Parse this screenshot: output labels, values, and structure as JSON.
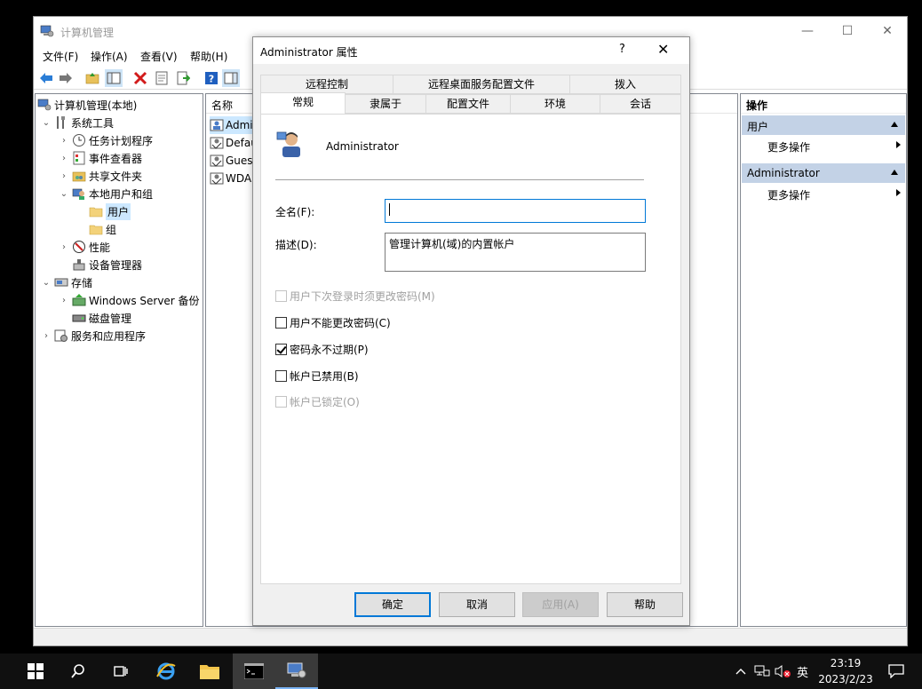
{
  "window": {
    "title": "计算机管理",
    "minimize": "—",
    "maximize": "☐",
    "close": "✕"
  },
  "menu": [
    "文件(F)",
    "操作(A)",
    "查看(V)",
    "帮助(H)"
  ],
  "toolbar_icons": [
    "back-icon",
    "forward-icon",
    "up-folder-icon",
    "show-hide-tree-icon",
    "delete-icon",
    "properties-icon",
    "export-icon",
    "help-icon",
    "show-action-pane-icon"
  ],
  "tree": {
    "root": "计算机管理(本地)",
    "system_tools": "系统工具",
    "task_scheduler": "任务计划程序",
    "event_viewer": "事件查看器",
    "shared_folders": "共享文件夹",
    "local_users": "本地用户和组",
    "users": "用户",
    "groups": "组",
    "performance": "性能",
    "device_manager": "设备管理器",
    "storage": "存储",
    "windows_backup": "Windows Server 备份",
    "disk_mgmt": "磁盘管理",
    "services_apps": "服务和应用程序"
  },
  "list": {
    "header": "名称",
    "rows": [
      "Admi",
      "Defau",
      "Gues",
      "WDA"
    ]
  },
  "actions": {
    "header": "操作",
    "section1": "用户",
    "section1_item": "更多操作",
    "section2": "Administrator",
    "section2_item": "更多操作"
  },
  "dialog": {
    "title": "Administrator 属性",
    "help": "?",
    "close": "✕",
    "tabs_top": [
      "远程控制",
      "远程桌面服务配置文件",
      "拨入"
    ],
    "tabs_bottom": [
      "常规",
      "隶属于",
      "配置文件",
      "环境",
      "会话"
    ],
    "username": "Administrator",
    "fullname_label": "全名(F):",
    "fullname_value": "",
    "desc_label": "描述(D):",
    "desc_value": "管理计算机(域)的内置帐户",
    "cb_must_change": "用户下次登录时须更改密码(M)",
    "cb_cannot_change": "用户不能更改密码(C)",
    "cb_never_expires": "密码永不过期(P)",
    "cb_disabled": "帐户已禁用(B)",
    "cb_locked": "帐户已锁定(O)",
    "checked_never_expires": true,
    "ok": "确定",
    "cancel": "取消",
    "apply": "应用(A)",
    "helpbtn": "帮助"
  },
  "taskbar": {
    "ime": "英",
    "time": "23:19",
    "date": "2023/2/23"
  }
}
